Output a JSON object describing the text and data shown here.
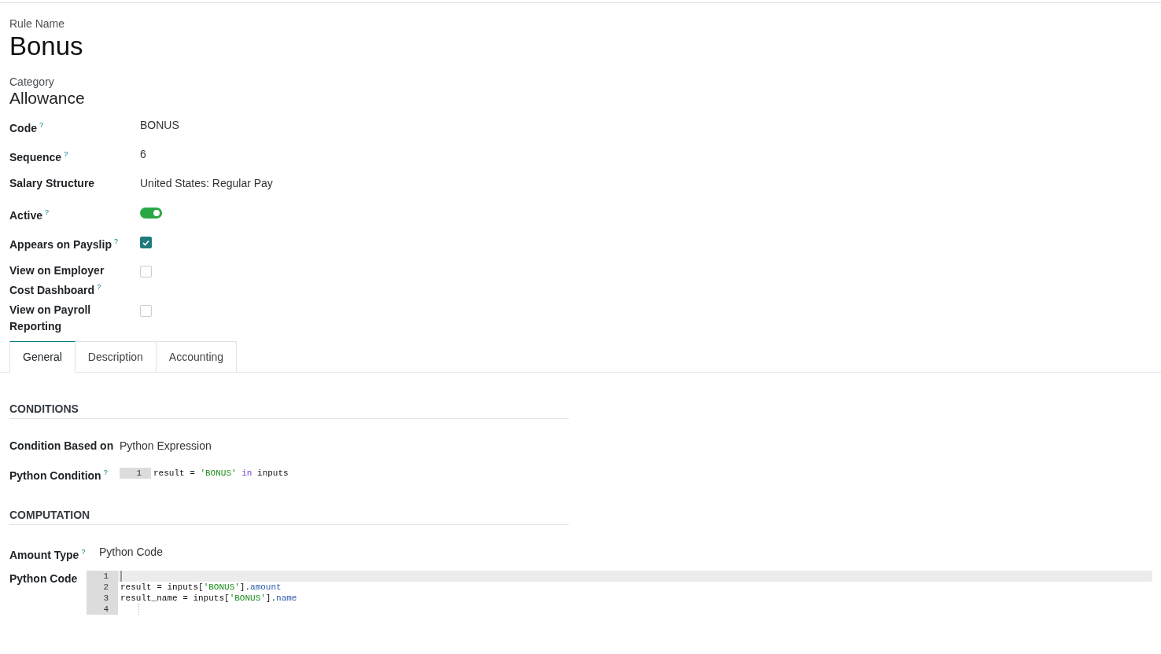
{
  "rule_name": {
    "label": "Rule Name",
    "value": "Bonus"
  },
  "category": {
    "label": "Category",
    "value": "Allowance"
  },
  "fields": [
    {
      "kind": "text",
      "label": "Code",
      "help": "?",
      "value": "BONUS"
    },
    {
      "kind": "text",
      "label": "Sequence",
      "help": "?",
      "value": "6"
    },
    {
      "kind": "text",
      "label": "Salary Structure",
      "value": "United States: Regular Pay"
    },
    {
      "kind": "toggle",
      "label": "Active",
      "help": "?",
      "on": true
    },
    {
      "kind": "checkbox",
      "label": "Appears on Payslip",
      "help": "?",
      "checked": true
    },
    {
      "kind": "checkbox",
      "label": "View on Employer Cost Dashboard",
      "help": "?",
      "checked": false
    },
    {
      "kind": "checkbox",
      "label": "View on Payroll Reporting",
      "checked": false
    }
  ],
  "tabs": [
    {
      "label": "General",
      "selected": true
    },
    {
      "label": "Description",
      "selected": false
    },
    {
      "label": "Accounting",
      "selected": false
    }
  ],
  "conditions": {
    "title": "CONDITIONS",
    "based_on": {
      "label": "Condition Based on",
      "value": "Python Expression"
    },
    "python_condition": {
      "label": "Python Condition",
      "help": "?",
      "lines": [
        {
          "number": "1",
          "tokens": [
            {
              "kind": "plain",
              "text": "result = "
            },
            {
              "kind": "string",
              "text": "'BONUS'"
            },
            {
              "kind": "keyword",
              "text": " in"
            },
            {
              "kind": "plain",
              "text": " inputs"
            }
          ]
        }
      ]
    }
  },
  "computation": {
    "title": "COMPUTATION",
    "amount_type": {
      "label": "Amount Type",
      "help": "?",
      "value": "Python Code"
    },
    "python_code": {
      "label": "Python Code",
      "lines": [
        {
          "number": "1",
          "active": true
        },
        {
          "number": "2",
          "active": false,
          "tokens": [
            {
              "kind": "plain",
              "text": "result = inputs["
            },
            {
              "kind": "string",
              "text": "'BONUS'"
            },
            {
              "kind": "plain",
              "text": "]."
            },
            {
              "kind": "attr",
              "text": "amount"
            }
          ]
        },
        {
          "number": "3",
          "active": false,
          "tokens": [
            {
              "kind": "plain",
              "text": "result_name = inputs["
            },
            {
              "kind": "string",
              "text": "'BONUS'"
            },
            {
              "kind": "plain",
              "text": "]."
            },
            {
              "kind": "attr",
              "text": "name"
            }
          ]
        },
        {
          "number": "4",
          "active": false
        }
      ]
    }
  }
}
